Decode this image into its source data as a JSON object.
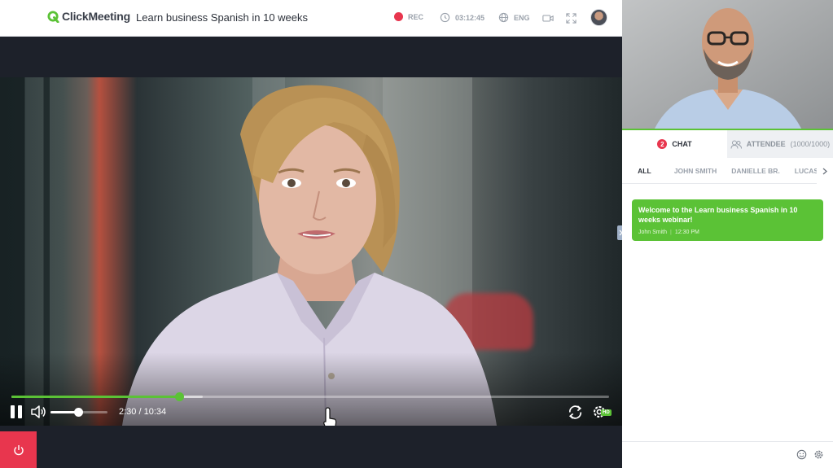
{
  "app": {
    "brand": "ClickMeeting",
    "title": "Learn business Spanish in 10 weeks"
  },
  "topbar": {
    "rec_label": "REC",
    "timer": "03:12:45",
    "language": "ENG",
    "icons": [
      "record-dot",
      "clock-icon",
      "globe-icon",
      "camera-icon",
      "fullscreen-icon",
      "user-avatar"
    ]
  },
  "player": {
    "time_display": "2:30 / 10:34",
    "progress": 0.28,
    "buffered": 0.32,
    "volume": 0.48,
    "hd_label": "HD",
    "accent_color": "#5bc236"
  },
  "panel": {
    "tabs": [
      {
        "label": "CHAT",
        "badge": "2"
      },
      {
        "label": "ATTENDEE",
        "count": "(1000/1000)"
      }
    ],
    "filters": [
      "ALL",
      "JOHN SMITH",
      "DANIELLE BR.",
      "LUCAS G"
    ],
    "messages": [
      {
        "text": "Welcome to the Learn business Spanish in 10 weeks webinar!",
        "author": "John Smith",
        "time": "12:30 PM"
      }
    ]
  },
  "colors": {
    "accent": "#5bc236",
    "danger": "#e8364e",
    "dark": "#1d212a"
  }
}
